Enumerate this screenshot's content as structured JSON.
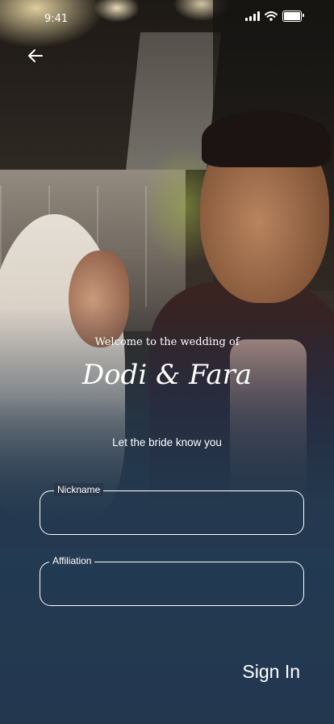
{
  "status_bar": {
    "time": "9:41",
    "icons": [
      "signal-icon",
      "wifi-icon",
      "battery-icon"
    ]
  },
  "nav": {
    "back_icon": "arrow-left-icon"
  },
  "hero": {
    "welcome": "Welcome to the wedding of",
    "couple_names": "Dodi & Fara",
    "prompt": "Let the bride know you"
  },
  "form": {
    "nickname": {
      "label": "Nickname",
      "value": ""
    },
    "affiliation": {
      "label": "Affiliation",
      "value": ""
    }
  },
  "actions": {
    "sign_in_label": "Sign In"
  },
  "colors": {
    "background": "#23384f",
    "text": "#ffffff"
  }
}
